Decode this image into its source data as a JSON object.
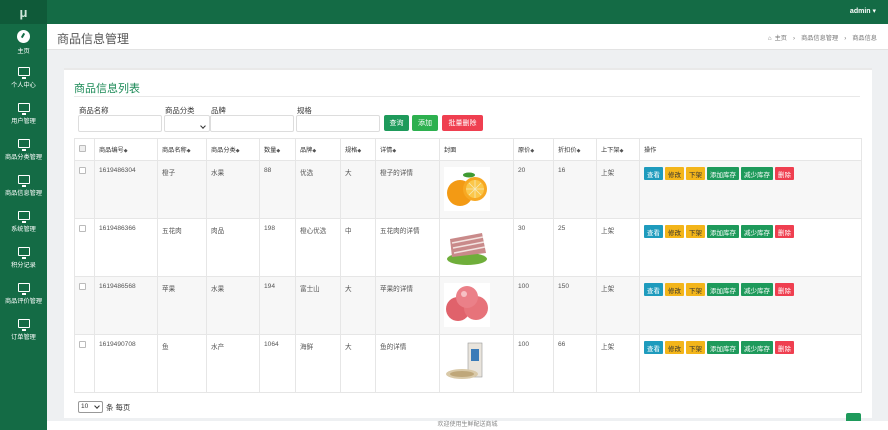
{
  "logo": "μ",
  "sidebar": {
    "items": [
      {
        "label": "主页",
        "icon": "dashboard-icon"
      },
      {
        "label": "个人中心",
        "icon": "monitor-icon"
      },
      {
        "label": "用户管理",
        "icon": "monitor-icon"
      },
      {
        "label": "商品分类管理",
        "icon": "monitor-icon"
      },
      {
        "label": "商品信息管理",
        "icon": "monitor-icon"
      },
      {
        "label": "系统管理",
        "icon": "monitor-icon"
      },
      {
        "label": "积分记录",
        "icon": "monitor-icon"
      },
      {
        "label": "商品评价管理",
        "icon": "monitor-icon"
      },
      {
        "label": "订单管理",
        "icon": "monitor-icon"
      }
    ]
  },
  "topbar": {
    "user": "admin ▾"
  },
  "header": {
    "title": "商品信息管理",
    "breadcrumb": [
      "主页",
      "›",
      "商品信息管理",
      "›",
      "商品信息"
    ]
  },
  "card": {
    "title": "商品信息列表"
  },
  "filters": {
    "name_label": "商品名称",
    "category_label": "商品分类",
    "brand_label": "品牌",
    "spec_label": "规格",
    "name_value": "",
    "brand_value": "",
    "spec_value": ""
  },
  "buttons": {
    "search": "查询",
    "add": "添加",
    "batch_delete": "批量删除"
  },
  "table": {
    "headers": [
      "商品编号",
      "商品名称",
      "商品分类",
      "数量",
      "品牌",
      "规格",
      "详情",
      "封面",
      "原价",
      "折扣价",
      "上下架",
      "操作"
    ],
    "rows": [
      {
        "id": "1619486304",
        "name": "橙子",
        "category": "水果",
        "qty": "88",
        "brand": "优选",
        "spec": "大",
        "detail": "橙子的详情",
        "cover": "orange-image",
        "price": "20",
        "discount": "16",
        "status": "上架"
      },
      {
        "id": "1619486366",
        "name": "五花肉",
        "category": "肉品",
        "qty": "198",
        "brand": "橙心优选",
        "spec": "中",
        "detail": "五花肉的详情",
        "cover": "pork-image",
        "price": "30",
        "discount": "25",
        "status": "上架"
      },
      {
        "id": "1619486568",
        "name": "苹果",
        "category": "水果",
        "qty": "194",
        "brand": "富士山",
        "spec": "大",
        "detail": "苹果的详情",
        "cover": "apple-image",
        "price": "100",
        "discount": "150",
        "status": "上架"
      },
      {
        "id": "1619490708",
        "name": "鱼",
        "category": "水产",
        "qty": "1064",
        "brand": "海鲜",
        "spec": "大",
        "detail": "鱼的详情",
        "cover": "fish-image",
        "price": "100",
        "discount": "66",
        "status": "上架"
      }
    ],
    "ops": {
      "view": "查看",
      "edit": "修改",
      "offshelf": "下架",
      "add_stock": "添加库存",
      "reduce_stock": "减少库存",
      "delete": "删除"
    }
  },
  "pager": {
    "page_size": "10",
    "suffix": "条 每页"
  },
  "footer": {
    "text": "欢迎使用生鲜配送商城"
  },
  "colors": {
    "primary": "#146b45",
    "accent": "#1e9a5b",
    "danger": "#ef3f50",
    "warning": "#f3b51a",
    "info": "#1e9bbd"
  }
}
